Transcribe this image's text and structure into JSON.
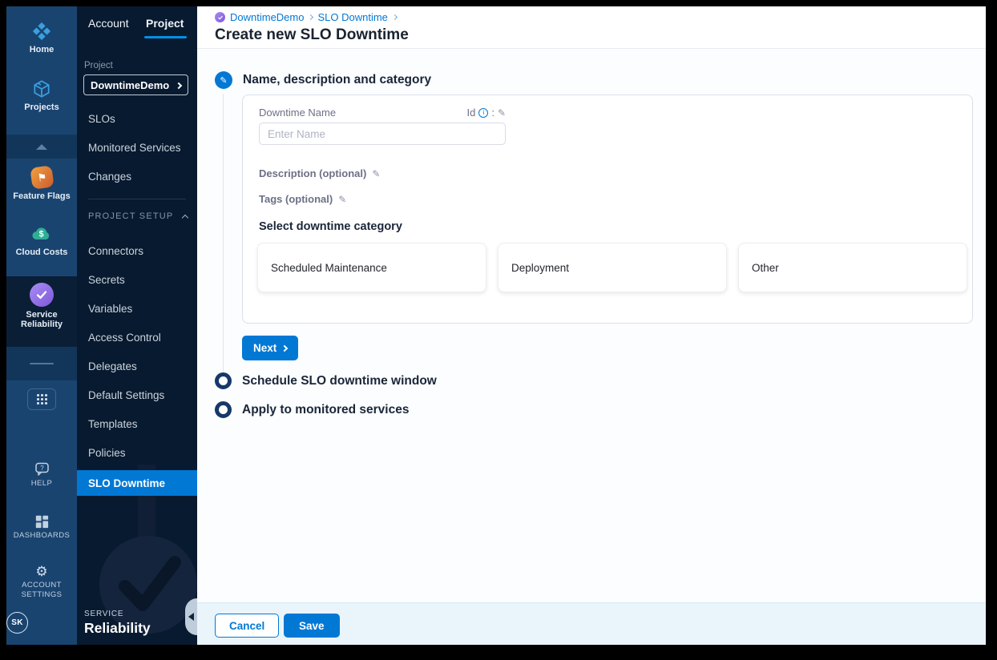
{
  "rail": {
    "modules": [
      {
        "label": "Home"
      },
      {
        "label": "Projects"
      },
      {
        "label": "Feature Flags"
      },
      {
        "label": "Cloud Costs"
      },
      {
        "label": "Service Reliability"
      }
    ],
    "bottom": [
      {
        "label": "HELP"
      },
      {
        "label": "DASHBOARDS"
      },
      {
        "label": "ACCOUNT SETTINGS"
      }
    ],
    "avatar": "SK"
  },
  "sidebar": {
    "tabs": {
      "account": "Account",
      "project": "Project"
    },
    "project_label": "Project",
    "project_selector": "DowntimeDemo",
    "nav_top": [
      "SLOs",
      "Monitored Services",
      "Changes"
    ],
    "section_header": "PROJECT SETUP",
    "nav_setup": [
      "Connectors",
      "Secrets",
      "Variables",
      "Access Control",
      "Delegates",
      "Default Settings",
      "Templates",
      "Policies"
    ],
    "active_item": "SLO Downtime",
    "module_kicker": "SERVICE",
    "module_name": "Reliability"
  },
  "header": {
    "breadcrumb": [
      "DowntimeDemo",
      "SLO Downtime"
    ],
    "title": "Create new SLO Downtime"
  },
  "form": {
    "step1_title": "Name, description and category",
    "name_label": "Downtime Name",
    "id_label": "Id",
    "id_separator": ":",
    "name_placeholder": "Enter Name",
    "description_label": "Description (optional)",
    "tags_label": "Tags (optional)",
    "category_label": "Select downtime category",
    "categories": [
      "Scheduled Maintenance",
      "Deployment",
      "Other"
    ],
    "next_label": "Next"
  },
  "steps": {
    "step2": "Schedule SLO downtime window",
    "step3": "Apply to monitored services"
  },
  "footer": {
    "cancel": "Cancel",
    "save": "Save"
  },
  "colors": {
    "primary": "#0278d5",
    "tab_underline": "#0092e4",
    "active_nav_bg": "#0278d5",
    "rail_bg": "#1a4470",
    "sidebar_bg": "#081a2f"
  }
}
